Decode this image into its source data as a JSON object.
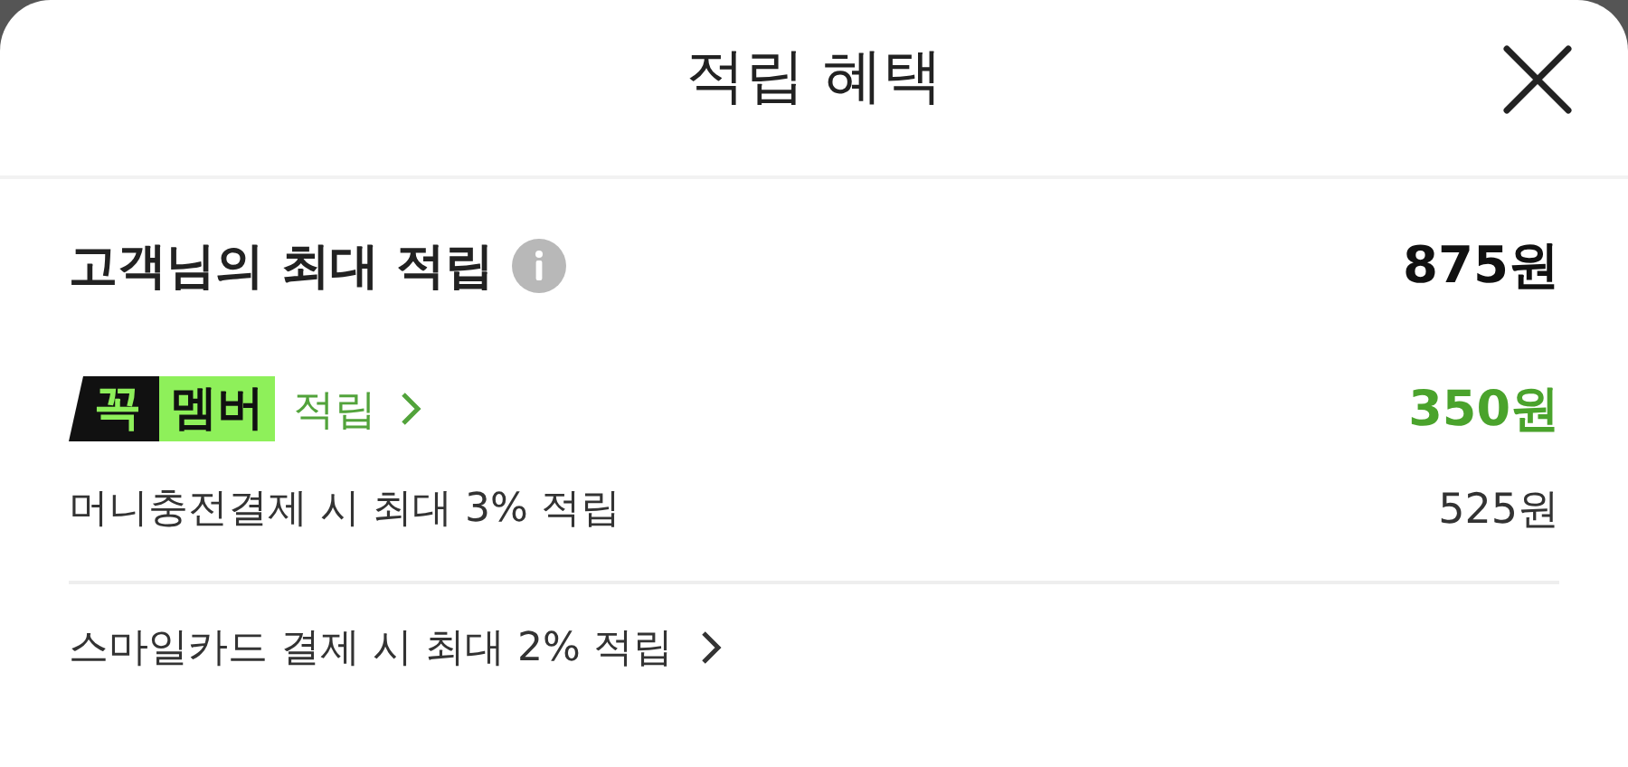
{
  "header": {
    "title": "적립 혜택"
  },
  "summary": {
    "label": "고객님의 최대 적립",
    "amount": "875원"
  },
  "member": {
    "badge_mark": "꼭",
    "badge_text": "멤버",
    "link": "적립",
    "amount": "350원"
  },
  "rows": [
    {
      "label": "머니충전결제 시 최대 3% 적립",
      "amount": "525원"
    }
  ],
  "footer_link": {
    "label": "스마일카드 결제 시 최대 2% 적립"
  }
}
